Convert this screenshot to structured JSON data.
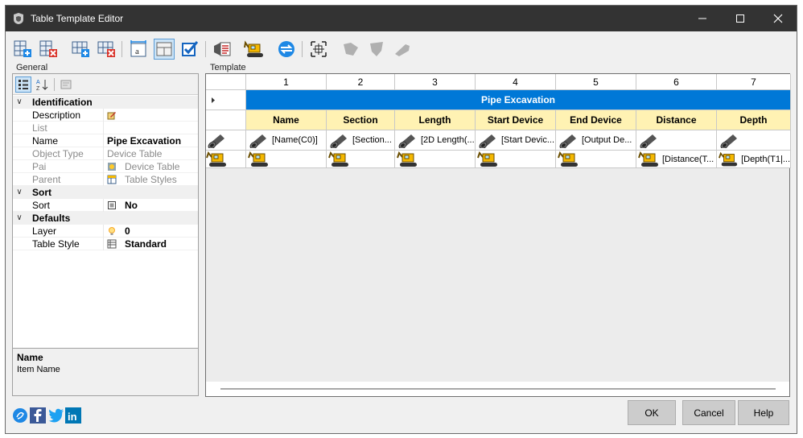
{
  "window": {
    "title": "Table Template Editor"
  },
  "panels": {
    "general_label": "General",
    "template_label": "Template"
  },
  "toolbar": {
    "buttons": [
      {
        "icon": "insert-column-icon"
      },
      {
        "icon": "delete-column-icon"
      },
      {
        "icon": "insert-row-icon"
      },
      {
        "icon": "delete-row-icon"
      },
      {
        "icon": "text-cell-icon"
      },
      {
        "icon": "merge-cells-icon"
      },
      {
        "icon": "checkbox-icon"
      },
      {
        "icon": "properties-list-icon"
      },
      {
        "icon": "excavator-icon"
      },
      {
        "icon": "refresh-icon"
      },
      {
        "icon": "select-frame-icon"
      },
      {
        "icon": "pipe-shape-disabled-icon"
      },
      {
        "icon": "pipe-bend-disabled-icon"
      },
      {
        "icon": "pipe-end-disabled-icon"
      }
    ]
  },
  "properties": [
    {
      "type": "category",
      "name": "Identification"
    },
    {
      "type": "prop",
      "name": "Description",
      "value": "",
      "icon": "edit-icon"
    },
    {
      "type": "prop",
      "name": "List",
      "value": "",
      "dim": true
    },
    {
      "type": "prop",
      "name": "Name",
      "value": "Pipe Excavation",
      "bold": true
    },
    {
      "type": "prop",
      "name": "Object Type",
      "value": "Device Table",
      "dim": true
    },
    {
      "type": "prop",
      "name": "Pai",
      "value": "Device Table",
      "dim": true,
      "icon": "device-icon"
    },
    {
      "type": "prop",
      "name": "Parent",
      "value": "Table Styles",
      "dim": true,
      "icon": "table-icon"
    },
    {
      "type": "category",
      "name": "Sort"
    },
    {
      "type": "prop",
      "name": "Sort",
      "value": "No",
      "bold": true,
      "icon": "checkbox-icon"
    },
    {
      "type": "category",
      "name": "Defaults"
    },
    {
      "type": "prop",
      "name": "Layer",
      "value": "0",
      "bold": true,
      "icon": "bulb-icon"
    },
    {
      "type": "prop",
      "name": "Table Style",
      "value": "Standard",
      "bold": true,
      "icon": "table-style-icon"
    }
  ],
  "description": {
    "title": "Name",
    "text": "Item Name"
  },
  "grid": {
    "column_numbers": [
      "1",
      "2",
      "3",
      "4",
      "5",
      "6",
      "7"
    ],
    "title": "Pipe Excavation",
    "headers": [
      "Name",
      "Section",
      "Length",
      "Start Device",
      "End Device",
      "Distance",
      "Depth"
    ],
    "row_pipe": [
      "[Name(C0)]",
      "[Section...",
      "[2D Length(...",
      "[Start Devic...",
      "[Output De...",
      "",
      ""
    ],
    "row_excavation": [
      "",
      "",
      "",
      "",
      "",
      "[Distance(T...",
      "[Depth(T1|..."
    ]
  },
  "buttons": {
    "ok": "OK",
    "cancel": "Cancel",
    "help": "Help"
  },
  "colors": {
    "titlebar": "#333333",
    "header_band": "#0078d7",
    "column_header": "#fff2b3"
  }
}
